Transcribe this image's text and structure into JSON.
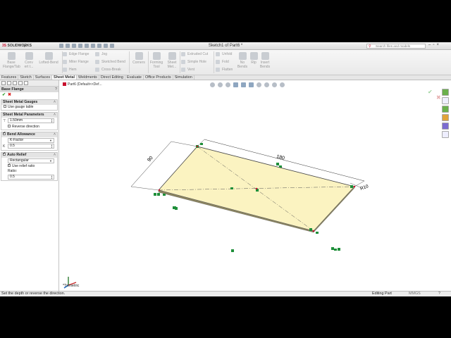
{
  "app": {
    "logo_brand": "3S",
    "logo_name": "SOLIDWORKS",
    "window_title": "Sketch1 of Part6 *",
    "search_placeholder": "Search files and models"
  },
  "ribbon": {
    "base_flange": "Base Flange/Tab",
    "convert": "Conv ert t...",
    "lofted_bend": "Lofted-Bend",
    "edge_flange": "Edge Flange",
    "miter_flange": "Miter Flange",
    "hem": "Hem",
    "jog": "Jog",
    "sketched_bend": "Sketched Bend",
    "cross_break": "Cross-Break",
    "corners": "Corners",
    "forming_tool": "Forming Tool",
    "sheet_metal": "Sheet Met...",
    "extruded_cut": "Extruded Cut",
    "simple_hole": "Simple Hole",
    "vent": "Vent",
    "unfold": "Unfold",
    "fold": "Fold",
    "flatten": "Flatten",
    "no_bends": "No Bends",
    "rip": "Rip",
    "insert_bends": "Insert Bends"
  },
  "tabs": [
    "Features",
    "Sketch",
    "Surfaces",
    "Sheet Metal",
    "Weldments",
    "Direct Editing",
    "Evaluate",
    "Office Products",
    "Simulation"
  ],
  "active_tab": "Sheet Metal",
  "property_manager": {
    "title": "Base Flange",
    "gauges": {
      "title": "Sheet Metal Gauges",
      "use_gauge_table": "Use gauge table"
    },
    "parameters": {
      "title": "Sheet Metal Parameters",
      "thickness": "1.50mm",
      "reverse_direction": "Reverse direction"
    },
    "bend_allowance": {
      "title": "Bend Allowance",
      "type": "K-Factor",
      "k_label": "K",
      "k_value": "0.5"
    },
    "auto_relief": {
      "title": "Auto Relief",
      "type": "Rectangular",
      "use_relief_ratio": "Use relief ratio",
      "ratio_label": "Ratio:",
      "ratio_value": "0.5"
    }
  },
  "viewport": {
    "breadcrumb": "Part6 (Default<<Def...",
    "view_orientation": "*Trimetric",
    "dimensions": {
      "length": "180",
      "width": "90",
      "radius": "R10"
    }
  },
  "status": {
    "message": "Set the depth or reverse the direction.",
    "mode": "Editing Part",
    "units": "MMGS",
    "help": "?"
  },
  "colors": {
    "plate_fill": "#fbf3c1",
    "sketch_line": "#222222",
    "relation_green": "#1f8f3a",
    "accent_red": "#c8102e"
  }
}
